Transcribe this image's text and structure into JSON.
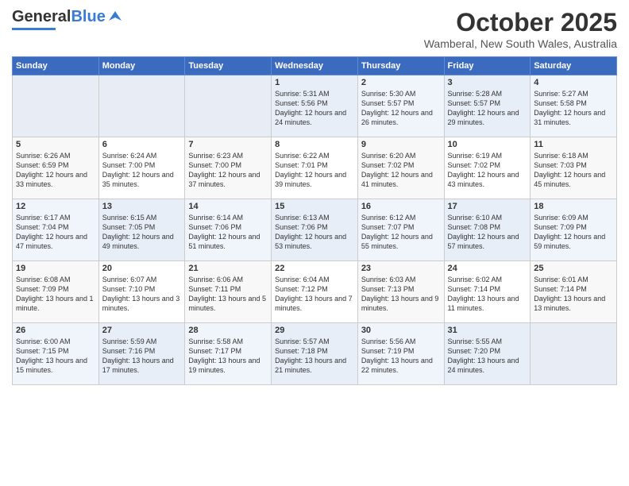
{
  "header": {
    "logo_general": "General",
    "logo_blue": "Blue",
    "month": "October 2025",
    "location": "Wamberal, New South Wales, Australia"
  },
  "weekdays": [
    "Sunday",
    "Monday",
    "Tuesday",
    "Wednesday",
    "Thursday",
    "Friday",
    "Saturday"
  ],
  "weeks": [
    [
      {
        "day": "",
        "info": ""
      },
      {
        "day": "",
        "info": ""
      },
      {
        "day": "",
        "info": ""
      },
      {
        "day": "1",
        "info": "Sunrise: 5:31 AM\nSunset: 5:56 PM\nDaylight: 12 hours and 24 minutes."
      },
      {
        "day": "2",
        "info": "Sunrise: 5:30 AM\nSunset: 5:57 PM\nDaylight: 12 hours and 26 minutes."
      },
      {
        "day": "3",
        "info": "Sunrise: 5:28 AM\nSunset: 5:57 PM\nDaylight: 12 hours and 29 minutes."
      },
      {
        "day": "4",
        "info": "Sunrise: 5:27 AM\nSunset: 5:58 PM\nDaylight: 12 hours and 31 minutes."
      }
    ],
    [
      {
        "day": "5",
        "info": "Sunrise: 6:26 AM\nSunset: 6:59 PM\nDaylight: 12 hours and 33 minutes."
      },
      {
        "day": "6",
        "info": "Sunrise: 6:24 AM\nSunset: 7:00 PM\nDaylight: 12 hours and 35 minutes."
      },
      {
        "day": "7",
        "info": "Sunrise: 6:23 AM\nSunset: 7:00 PM\nDaylight: 12 hours and 37 minutes."
      },
      {
        "day": "8",
        "info": "Sunrise: 6:22 AM\nSunset: 7:01 PM\nDaylight: 12 hours and 39 minutes."
      },
      {
        "day": "9",
        "info": "Sunrise: 6:20 AM\nSunset: 7:02 PM\nDaylight: 12 hours and 41 minutes."
      },
      {
        "day": "10",
        "info": "Sunrise: 6:19 AM\nSunset: 7:02 PM\nDaylight: 12 hours and 43 minutes."
      },
      {
        "day": "11",
        "info": "Sunrise: 6:18 AM\nSunset: 7:03 PM\nDaylight: 12 hours and 45 minutes."
      }
    ],
    [
      {
        "day": "12",
        "info": "Sunrise: 6:17 AM\nSunset: 7:04 PM\nDaylight: 12 hours and 47 minutes."
      },
      {
        "day": "13",
        "info": "Sunrise: 6:15 AM\nSunset: 7:05 PM\nDaylight: 12 hours and 49 minutes."
      },
      {
        "day": "14",
        "info": "Sunrise: 6:14 AM\nSunset: 7:06 PM\nDaylight: 12 hours and 51 minutes."
      },
      {
        "day": "15",
        "info": "Sunrise: 6:13 AM\nSunset: 7:06 PM\nDaylight: 12 hours and 53 minutes."
      },
      {
        "day": "16",
        "info": "Sunrise: 6:12 AM\nSunset: 7:07 PM\nDaylight: 12 hours and 55 minutes."
      },
      {
        "day": "17",
        "info": "Sunrise: 6:10 AM\nSunset: 7:08 PM\nDaylight: 12 hours and 57 minutes."
      },
      {
        "day": "18",
        "info": "Sunrise: 6:09 AM\nSunset: 7:09 PM\nDaylight: 12 hours and 59 minutes."
      }
    ],
    [
      {
        "day": "19",
        "info": "Sunrise: 6:08 AM\nSunset: 7:09 PM\nDaylight: 13 hours and 1 minute."
      },
      {
        "day": "20",
        "info": "Sunrise: 6:07 AM\nSunset: 7:10 PM\nDaylight: 13 hours and 3 minutes."
      },
      {
        "day": "21",
        "info": "Sunrise: 6:06 AM\nSunset: 7:11 PM\nDaylight: 13 hours and 5 minutes."
      },
      {
        "day": "22",
        "info": "Sunrise: 6:04 AM\nSunset: 7:12 PM\nDaylight: 13 hours and 7 minutes."
      },
      {
        "day": "23",
        "info": "Sunrise: 6:03 AM\nSunset: 7:13 PM\nDaylight: 13 hours and 9 minutes."
      },
      {
        "day": "24",
        "info": "Sunrise: 6:02 AM\nSunset: 7:14 PM\nDaylight: 13 hours and 11 minutes."
      },
      {
        "day": "25",
        "info": "Sunrise: 6:01 AM\nSunset: 7:14 PM\nDaylight: 13 hours and 13 minutes."
      }
    ],
    [
      {
        "day": "26",
        "info": "Sunrise: 6:00 AM\nSunset: 7:15 PM\nDaylight: 13 hours and 15 minutes."
      },
      {
        "day": "27",
        "info": "Sunrise: 5:59 AM\nSunset: 7:16 PM\nDaylight: 13 hours and 17 minutes."
      },
      {
        "day": "28",
        "info": "Sunrise: 5:58 AM\nSunset: 7:17 PM\nDaylight: 13 hours and 19 minutes."
      },
      {
        "day": "29",
        "info": "Sunrise: 5:57 AM\nSunset: 7:18 PM\nDaylight: 13 hours and 21 minutes."
      },
      {
        "day": "30",
        "info": "Sunrise: 5:56 AM\nSunset: 7:19 PM\nDaylight: 13 hours and 22 minutes."
      },
      {
        "day": "31",
        "info": "Sunrise: 5:55 AM\nSunset: 7:20 PM\nDaylight: 13 hours and 24 minutes."
      },
      {
        "day": "",
        "info": ""
      }
    ]
  ]
}
